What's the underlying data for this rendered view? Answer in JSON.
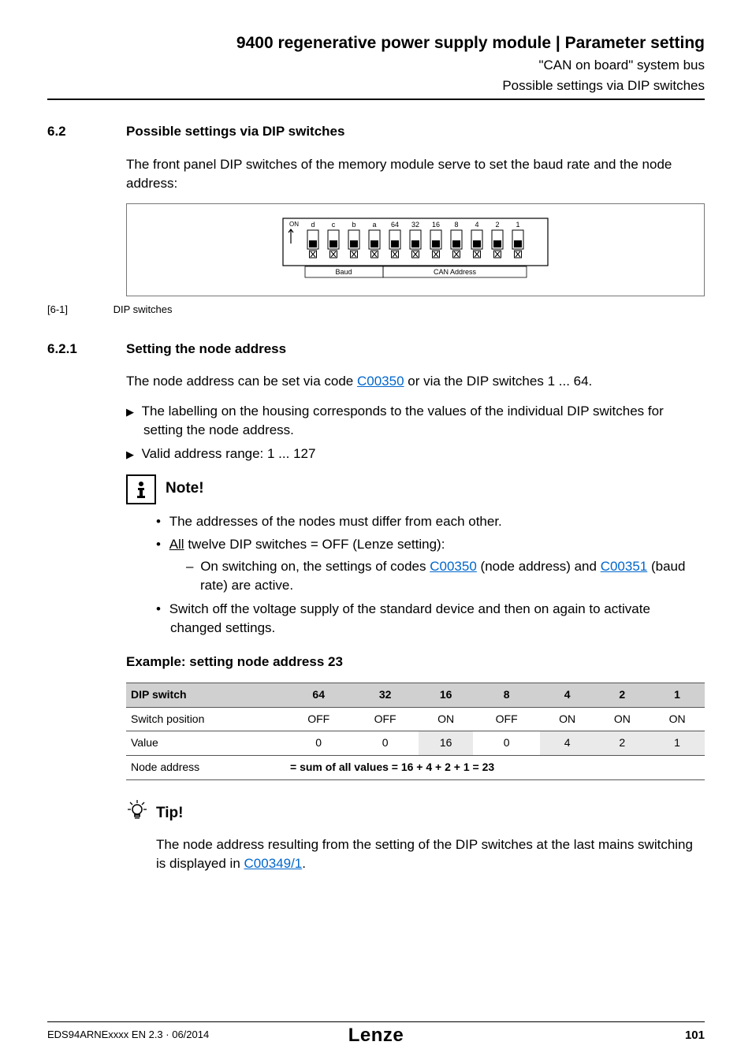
{
  "header": {
    "title": "9400 regenerative power supply module | Parameter setting",
    "sub1": "\"CAN on board\" system bus",
    "sub2": "Possible settings via DIP switches"
  },
  "sec62": {
    "num": "6.2",
    "title": "Possible settings via DIP switches",
    "para": "The front panel DIP switches of the memory module serve to set the baud rate and the node address:"
  },
  "dip_labels": {
    "on": "ON",
    "letters": [
      "d",
      "c",
      "b",
      "a"
    ],
    "numbers": [
      "64",
      "32",
      "16",
      "8",
      "4",
      "2",
      "1"
    ],
    "baud": "Baud",
    "can": "CAN Address"
  },
  "caption": {
    "id": "[6-1]",
    "text": "DIP switches"
  },
  "sec621": {
    "num": "6.2.1",
    "title": "Setting the node address",
    "intro_pre": "The node address can be set via code ",
    "intro_link": "C00350",
    "intro_post": " or via the DIP switches 1 ... 64.",
    "bullet1": "The labelling on the housing corresponds to the values of the individual DIP switches for setting the node address.",
    "bullet2": "Valid address range: 1 ... 127"
  },
  "note": {
    "title": "Note!",
    "item1": "The addresses of the nodes must differ from each other.",
    "item2_pre": "",
    "item2_all": "All",
    "item2_post": " twelve DIP switches = OFF (Lenze setting):",
    "dash_pre": "On switching on, the settings of codes ",
    "dash_link1": "C00350",
    "dash_mid": " (node address) and ",
    "dash_link2": "C00351",
    "dash_post": " (baud rate) are active.",
    "item3": "Switch off the voltage supply of the standard device and then on again to activate changed settings."
  },
  "example": {
    "title": "Example: setting node address 23"
  },
  "table": {
    "h0": "DIP switch",
    "h": [
      "64",
      "32",
      "16",
      "8",
      "4",
      "2",
      "1"
    ],
    "r1_label": "Switch position",
    "r1": [
      "OFF",
      "OFF",
      "ON",
      "OFF",
      "ON",
      "ON",
      "ON"
    ],
    "r2_label": "Value",
    "r2": [
      "0",
      "0",
      "16",
      "0",
      "4",
      "2",
      "1"
    ],
    "r3_label": "Node address",
    "r3_text": "= sum of all values = 16 + 4 + 2 + 1 = 23"
  },
  "tip": {
    "title": "Tip!",
    "text_pre": "The node address resulting from the setting of the DIP switches at the last mains switching is displayed in ",
    "text_link": "C00349/1",
    "text_post": "."
  },
  "footer": {
    "left": "EDS94ARNExxxx EN 2.3 · 06/2014",
    "logo": "Lenze",
    "right": "101"
  }
}
